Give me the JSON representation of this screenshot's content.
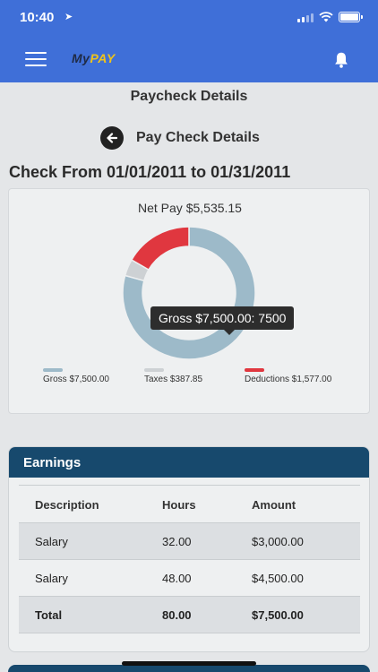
{
  "status_bar": {
    "time": "10:40",
    "location_icon": "location-arrow-icon"
  },
  "app_bar": {
    "logo_my": "My",
    "logo_pay": "PAY",
    "menu_icon": "hamburger-icon",
    "bell_icon": "bell-icon"
  },
  "page": {
    "title": "Paycheck Details",
    "subheader": "Pay Check Details",
    "check_range": "Check From 01/01/2011 to 01/31/2011"
  },
  "chart_data": {
    "type": "pie",
    "title": "Net Pay $5,535.15",
    "donut": true,
    "slices": [
      {
        "label": "Gross $7,500.00",
        "value": 7500,
        "color": "#9dbac9"
      },
      {
        "label": "Taxes $387.85",
        "value": 387.85,
        "color": "#cdd1d4"
      },
      {
        "label": "Deductions $1,577.00",
        "value": 1577,
        "color": "#e0373f"
      }
    ],
    "tooltip": "Gross $7,500.00: 7500",
    "legend_position": "bottom"
  },
  "earnings": {
    "title": "Earnings",
    "columns": [
      "Description",
      "Hours",
      "Amount"
    ],
    "rows": [
      [
        "Salary",
        "32.00",
        "$3,000.00"
      ],
      [
        "Salary",
        "48.00",
        "$4,500.00"
      ]
    ],
    "total": [
      "Total",
      "80.00",
      "$7,500.00"
    ]
  }
}
